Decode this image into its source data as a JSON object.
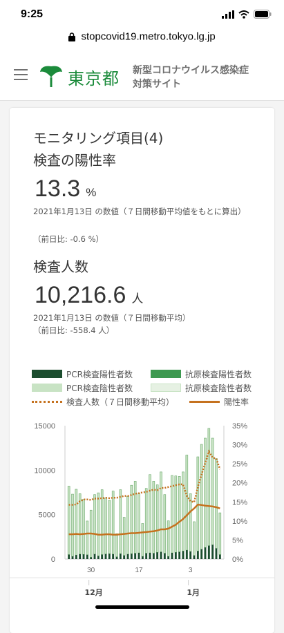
{
  "status": {
    "time": "9:25"
  },
  "browser": {
    "url": "stopcovid19.metro.tokyo.lg.jp"
  },
  "header": {
    "logo_text": "東京都",
    "site_title_line1": "新型コロナウイルス感染症",
    "site_title_line2": "対策サイト"
  },
  "card": {
    "title": "モニタリング項目(4)",
    "metric1": {
      "label": "検査の陽性率",
      "value": "13.3",
      "unit": "%",
      "note": "2021年1月13日 の数値（７日間移動平均値をもとに算出）",
      "diff": "（前日比: -0.6 %）"
    },
    "metric2": {
      "label": "検査人数",
      "value": "10,216.6",
      "unit": "人",
      "note": "2021年1月13日 の数値（７日間移動平均）",
      "diff": "（前日比: -558.4 人）"
    },
    "legend": {
      "pcr_positive": "PCR検査陽性者数",
      "antigen_positive": "抗原検査陽性者数",
      "pcr_negative": "PCR検査陰性者数",
      "antigen_negative": "抗原検査陰性者数",
      "tests_avg": "検査人数（７日間移動平均）",
      "positive_rate": "陽性率"
    }
  },
  "colors": {
    "pcr_positive": "#1b4d2e",
    "antigen_positive": "#3d9950",
    "pcr_negative": "#c8e3c4",
    "antigen_negative": "#e6f1e3",
    "tests_avg": "#c5721f",
    "positive_rate": "#c5721f",
    "brand": "#1b8b3b"
  },
  "chart_data": {
    "type": "bar",
    "left_axis": {
      "ticks": [
        "15000",
        "10000",
        "5000",
        "0"
      ],
      "ylim": [
        0,
        15000
      ]
    },
    "right_axis": {
      "ticks": [
        "35%",
        "30%",
        "25%",
        "20%",
        "15%",
        "10%",
        "5%",
        "0%"
      ],
      "ylim": [
        0,
        35
      ]
    },
    "x_day_ticks": [
      "30",
      "17",
      "3"
    ],
    "x_month_ticks": [
      "12月",
      "1月"
    ],
    "series": [
      {
        "name": "PCR検査陽性者数",
        "values": [
          500,
          300,
          450,
          550,
          520,
          480,
          200,
          550,
          350,
          500,
          560,
          600,
          550,
          250,
          600,
          400,
          550,
          600,
          650,
          700,
          300,
          650,
          700,
          650,
          750,
          800,
          650,
          300,
          700,
          750,
          800,
          900,
          1000,
          850,
          400,
          900,
          1100,
          1300,
          1500,
          1600,
          1200,
          500
        ]
      },
      {
        "name": "PCR検査陰性者数",
        "values": [
          7700,
          7000,
          7400,
          6800,
          6200,
          3800,
          5300,
          6700,
          7100,
          7300,
          6300,
          6000,
          7100,
          2600,
          7200,
          4300,
          6500,
          7700,
          8100,
          6700,
          3700,
          7300,
          8800,
          8100,
          7600,
          9000,
          6600,
          4000,
          8700,
          8600,
          8500,
          8900,
          10700,
          6500,
          3800,
          10600,
          11800,
          12300,
          13200,
          12000,
          10100,
          4700
        ]
      },
      {
        "name": "検査人数（７日間移動平均）",
        "values": [
          6100,
          6100,
          6150,
          6500,
          6700,
          6700,
          6650,
          6800,
          6800,
          6850,
          6900,
          6850,
          6900,
          6900,
          7000,
          7100,
          7100,
          7200,
          7350,
          7400,
          7500,
          7550,
          7700,
          7800,
          7750,
          8000,
          8000,
          8100,
          8200,
          8300,
          8400,
          8400,
          7100,
          6500,
          6400,
          8100,
          9500,
          10800,
          12100,
          11400,
          11300,
          10100
        ]
      },
      {
        "name": "陽性率",
        "values": [
          6.5,
          6.5,
          6.6,
          6.5,
          6.6,
          6.7,
          6.7,
          6.6,
          6.4,
          6.4,
          6.5,
          6.5,
          6.4,
          6.4,
          6.5,
          6.6,
          6.7,
          6.8,
          6.8,
          6.9,
          7.0,
          7.1,
          7.2,
          7.3,
          7.5,
          7.8,
          7.8,
          8.0,
          8.5,
          9.0,
          9.8,
          10.5,
          11.5,
          12.5,
          13.3,
          14.3,
          14.2,
          14.0,
          13.9,
          13.8,
          13.6,
          13.3
        ]
      }
    ]
  }
}
